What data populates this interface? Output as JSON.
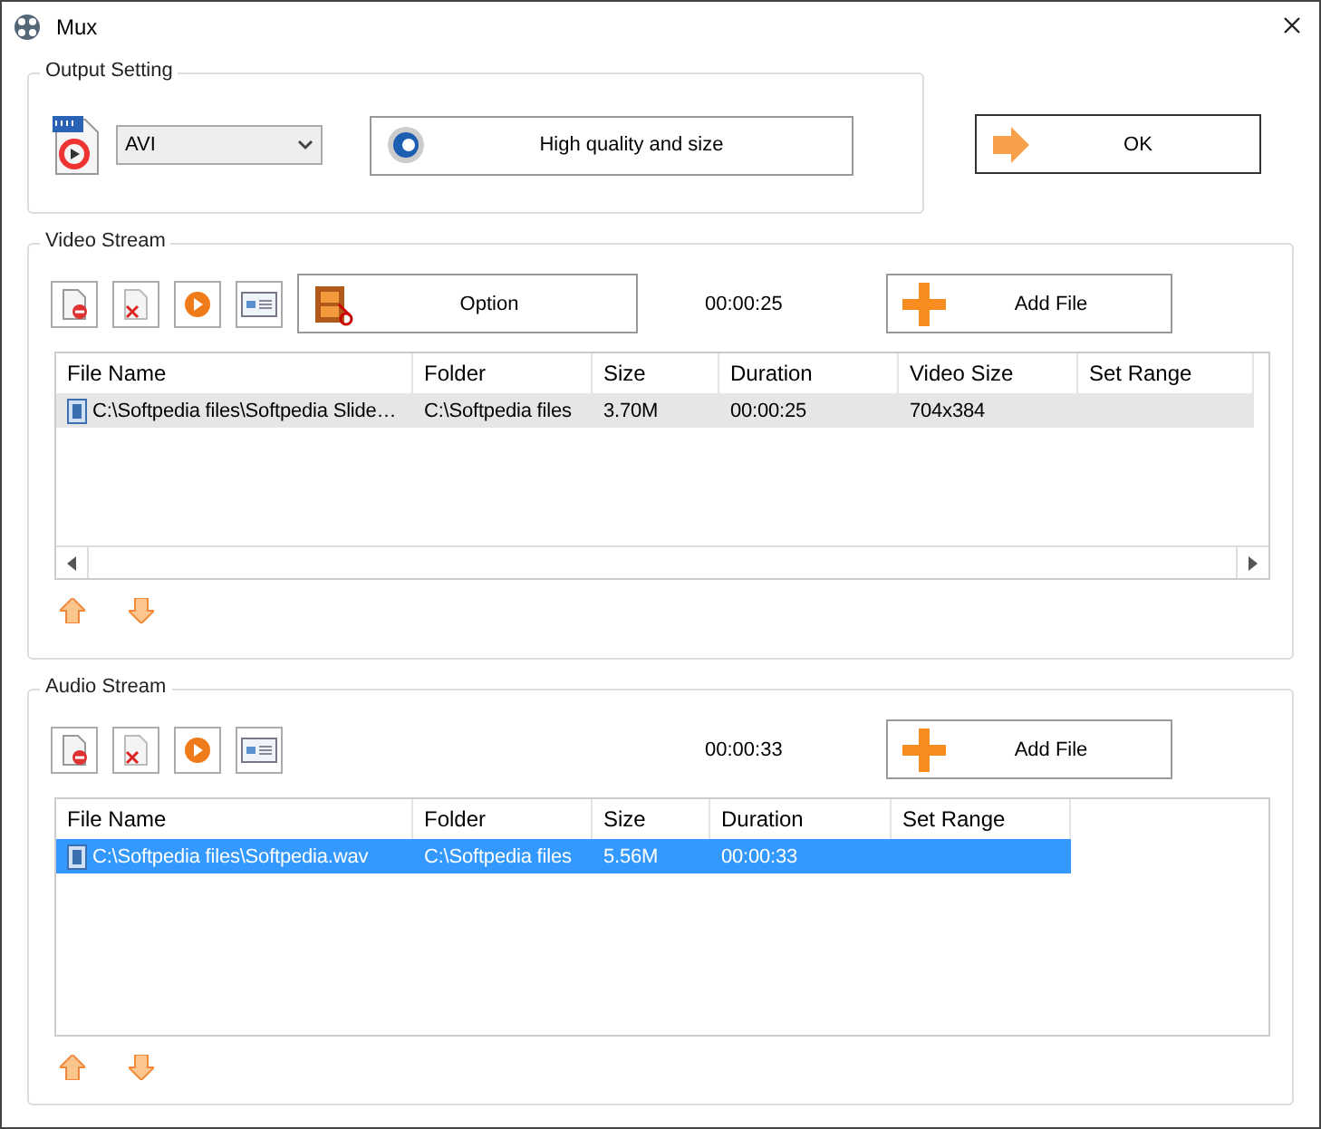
{
  "window": {
    "title": "Mux"
  },
  "output_setting": {
    "label": "Output Setting",
    "format": "AVI",
    "quality_button": "High quality and size"
  },
  "ok_button": "OK",
  "video_stream": {
    "label": "Video Stream",
    "option_button": "Option",
    "duration": "00:00:25",
    "add_button": "Add File",
    "focused": false,
    "columns": [
      "File Name",
      "Folder",
      "Size",
      "Duration",
      "Video Size",
      "Set Range"
    ],
    "rows": [
      {
        "cells": [
          "C:\\Softpedia files\\Softpedia Slide…",
          "C:\\Softpedia files",
          "3.70M",
          "00:00:25",
          "704x384",
          ""
        ],
        "selected": true
      }
    ]
  },
  "audio_stream": {
    "label": "Audio Stream",
    "duration": "00:00:33",
    "add_button": "Add File",
    "focused": true,
    "columns": [
      "File Name",
      "Folder",
      "Size",
      "Duration",
      "Set Range"
    ],
    "rows": [
      {
        "cells": [
          "C:\\Softpedia files\\Softpedia.wav",
          "C:\\Softpedia files",
          "5.56M",
          "00:00:33",
          ""
        ],
        "selected": true
      }
    ]
  }
}
